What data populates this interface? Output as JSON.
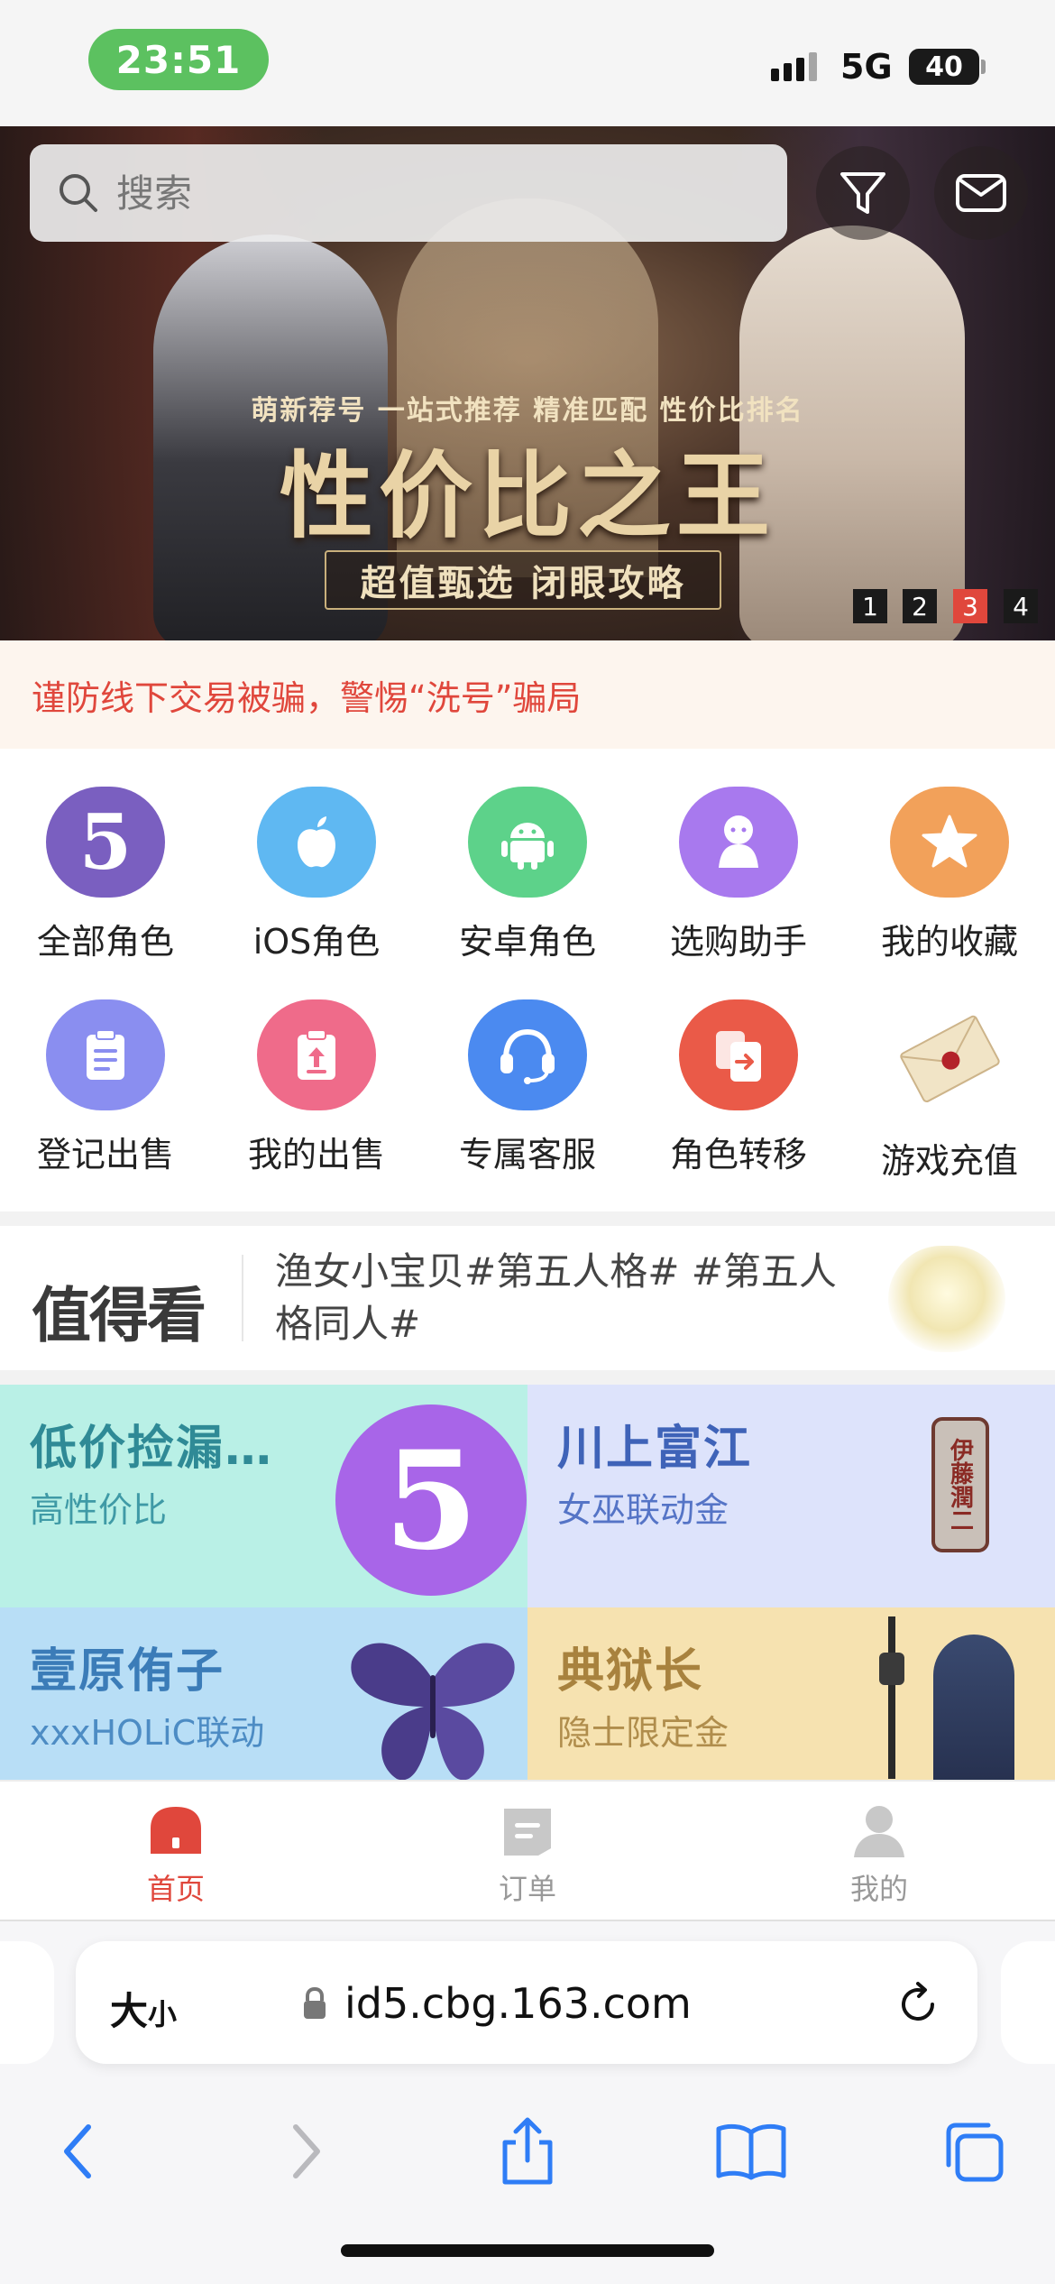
{
  "status_bar": {
    "time": "23:51",
    "network": "5G",
    "battery": "40"
  },
  "search": {
    "placeholder": "搜索"
  },
  "banner": {
    "subtitle": "萌新荐号 一站式推荐 精准匹配 性价比排名",
    "title": "性价比之王",
    "tagline": "超值甄选 闭眼攻略",
    "pages": [
      "1",
      "2",
      "3",
      "4"
    ],
    "active_page": "3"
  },
  "notice": {
    "text": "谨防线下交易被骗，警惕“洗号”骗局"
  },
  "grid": {
    "items": [
      {
        "label": "全部角色",
        "icon": "game-logo-icon",
        "color": "#7a5fc0"
      },
      {
        "label": "iOS角色",
        "icon": "apple-icon",
        "color": "#5fb8f2"
      },
      {
        "label": "安卓角色",
        "icon": "android-icon",
        "color": "#5dd28a"
      },
      {
        "label": "选购助手",
        "icon": "assistant-icon",
        "color": "#a879ee"
      },
      {
        "label": "我的收藏",
        "icon": "star-icon",
        "color": "#f2a15a"
      },
      {
        "label": "登记出售",
        "icon": "clipboard-icon",
        "color": "#8a8ef0"
      },
      {
        "label": "我的出售",
        "icon": "upload-icon",
        "color": "#ef6b8a"
      },
      {
        "label": "专属客服",
        "icon": "headset-icon",
        "color": "#4b8af0"
      },
      {
        "label": "角色转移",
        "icon": "transfer-icon",
        "color": "#ea5a48"
      },
      {
        "label": "游戏充值",
        "icon": "envelope-icon",
        "color": "#f3e7d2"
      }
    ]
  },
  "worth": {
    "logo": "值得看",
    "text": "渔女小宝贝#第五人格# #第五人格同人#"
  },
  "cards": [
    {
      "title": "低价捡漏…",
      "subtitle": "高性价比",
      "bg": "#b9f0e6",
      "title_color": "#2f8a96",
      "sub_color": "#3f9aa6"
    },
    {
      "title": "川上富江",
      "subtitle": "女巫联动金",
      "bg": "#dde3fb",
      "title_color": "#3f63b8",
      "sub_color": "#5574c6"
    },
    {
      "title": "壹原侑子",
      "subtitle": "xxxHOLiC联动",
      "bg": "#b8def6",
      "title_color": "#3b7cb8",
      "sub_color": "#4d8cc4"
    },
    {
      "title": "典狱长",
      "subtitle": "隐士限定金",
      "bg": "#f6e2b0",
      "title_color": "#a8823e",
      "sub_color": "#b08d4c"
    }
  ],
  "card_art": {
    "stamp_text": "伊藤潤二"
  },
  "tabbar": {
    "tabs": [
      {
        "label": "首页",
        "icon": "home-icon"
      },
      {
        "label": "订单",
        "icon": "order-icon"
      },
      {
        "label": "我的",
        "icon": "profile-icon"
      }
    ],
    "active": "首页"
  },
  "browser": {
    "text_size": "大",
    "text_size_small": "小",
    "url": "id5.cbg.163.com"
  },
  "colors": {
    "accent": "#e0473c",
    "safari_blue": "#2f7df6"
  }
}
